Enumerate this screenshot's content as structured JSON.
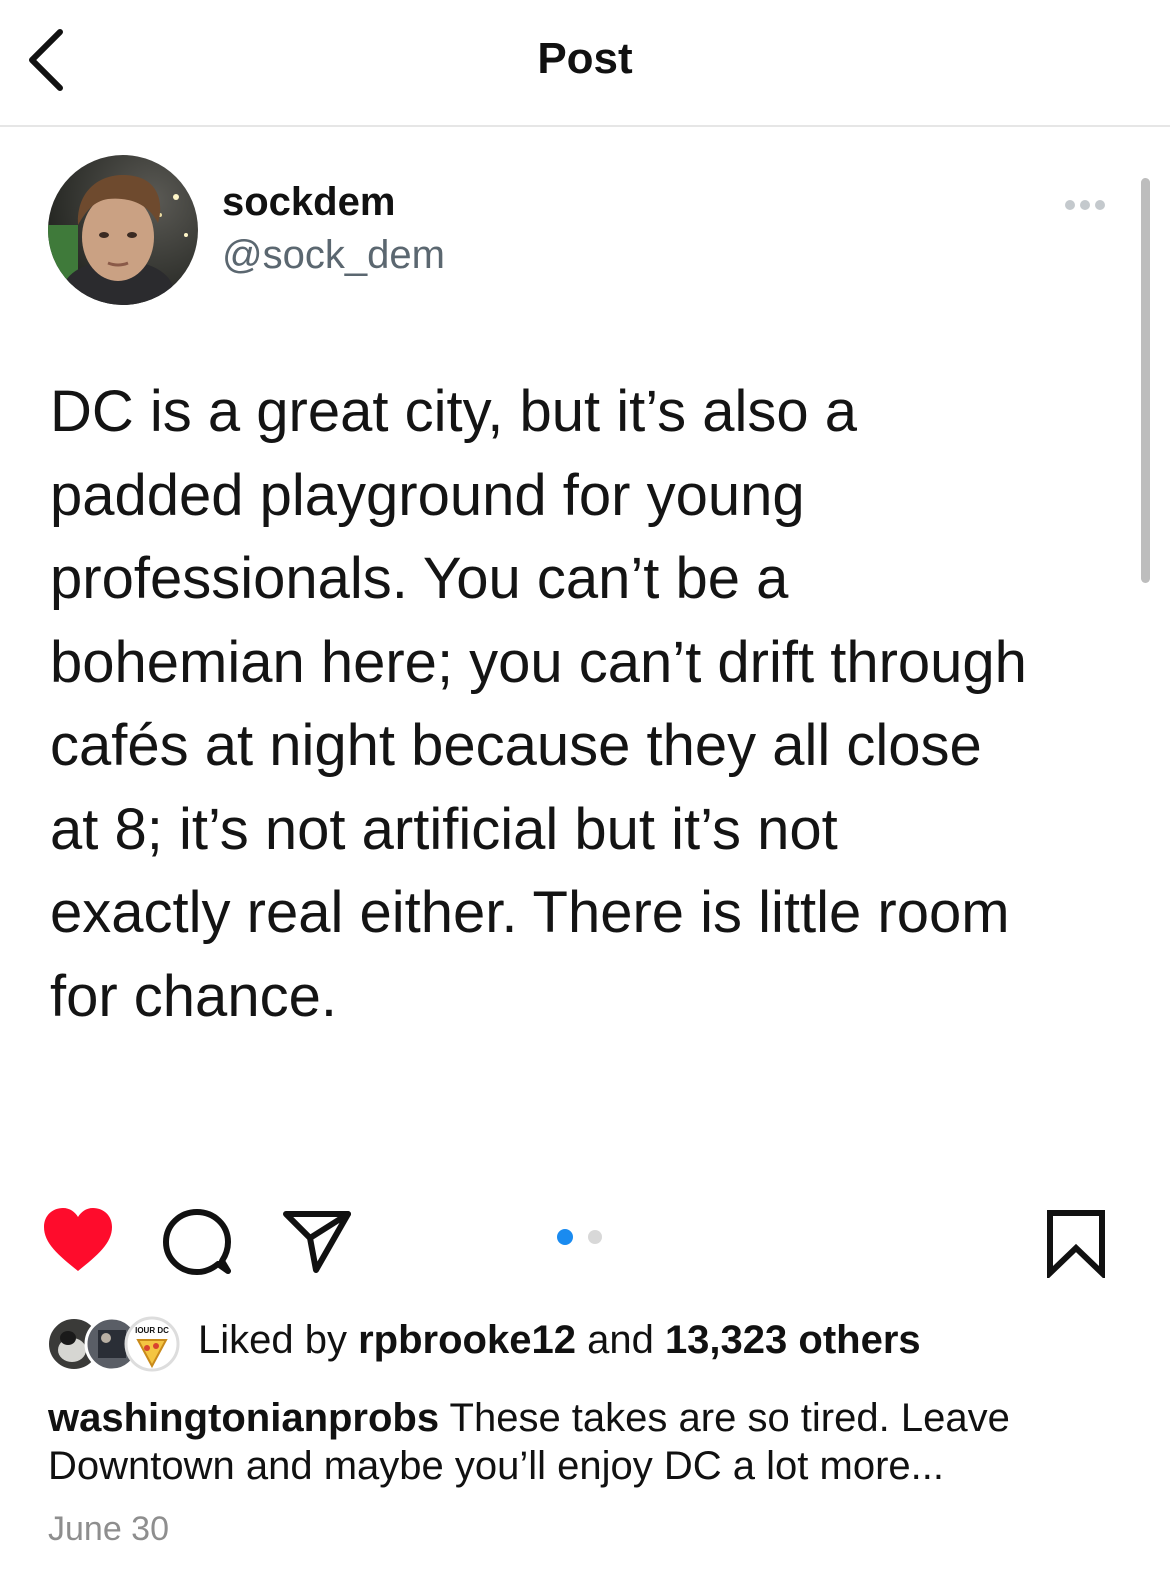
{
  "header": {
    "title": "Post",
    "back_icon": "chevron-left-icon"
  },
  "post": {
    "author": {
      "display_name": "sockdem",
      "handle": "@sock_dem",
      "avatar_icon": "profile-photo-avatar"
    },
    "more_icon": "more-horizontal-icon",
    "text_lines": [
      "DC is a great city, but it’s also a",
      "padded playground for young",
      "professionals. You can’t be a",
      "bohemian here; you can’t drift through",
      "cafés at night because they all close",
      "at 8; it’s not artificial but it’s not",
      "exactly real either. There is little room",
      "for chance."
    ]
  },
  "actions": {
    "like_icon": "heart-filled-icon",
    "comment_icon": "comment-icon",
    "share_icon": "paper-plane-icon",
    "bookmark_icon": "bookmark-icon",
    "carousel": {
      "count": 2,
      "active_index": 0
    },
    "colors": {
      "like": "#fe0c2c",
      "carousel_active": "#1a8bf0",
      "carousel_inactive": "#d8d8d8"
    }
  },
  "likes": {
    "prefix": "Liked by ",
    "user": "rpbrooke12",
    "connector": " and ",
    "others": "13,323 others",
    "liker_avatar_badge_text": "IOUR DC"
  },
  "caption": {
    "username": "washingtonianprobs",
    "text": "These takes are so tired. Leave Downtown and maybe you’ll enjoy DC a lot more..."
  },
  "date": "June 30"
}
